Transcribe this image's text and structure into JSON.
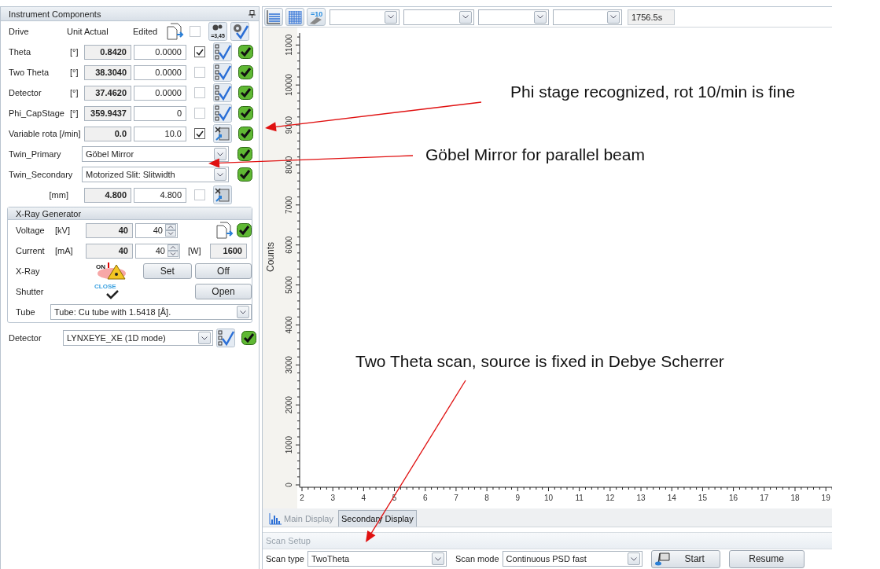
{
  "panel": {
    "title": "Instrument Components",
    "header": {
      "drive": "Drive",
      "unit_actual": "Unit Actual",
      "edited": "Edited",
      "icon_text": "=3,45",
      "checked": false
    },
    "drives": [
      {
        "kind": "axis",
        "label": "Theta",
        "unit": "[°]",
        "actual": "0.8420",
        "edited": "0.0000",
        "checked": true
      },
      {
        "kind": "axis",
        "label": "Two Theta",
        "unit": "[°]",
        "actual": "38.3040",
        "edited": "0.0000",
        "checked": false
      },
      {
        "kind": "axis",
        "label": "Detector",
        "unit": "[°]",
        "actual": "37.4620",
        "edited": "0.0000",
        "checked": false
      },
      {
        "kind": "axis",
        "label": "Phi_CapStage",
        "unit": "[°]",
        "actual": "359.9437",
        "edited": "0",
        "checked": false
      },
      {
        "kind": "rotation",
        "label": "Variable rota [/min]",
        "actual": "0.0",
        "edited": "10.0",
        "checked": true
      }
    ],
    "selectors": [
      {
        "label": "Twin_Primary",
        "value": "Göbel Mirror"
      },
      {
        "label": "Twin_Secondary",
        "value": "Motorized Slit: Slitwidth"
      }
    ],
    "slit": {
      "unit": "[mm]",
      "actual": "4.800",
      "edited": "4.800",
      "checked": false
    },
    "generator": {
      "title": "X-Ray Generator",
      "voltage": {
        "label": "Voltage",
        "unit": "[kV]",
        "actual": "40",
        "edited": "40"
      },
      "current": {
        "label": "Current",
        "unit": "[mA]",
        "actual": "40",
        "edited": "40"
      },
      "power_unit": "[W]",
      "power": "1600",
      "xray": {
        "label": "X-Ray",
        "badge": "ON",
        "set": "Set",
        "off": "Off"
      },
      "shutter": {
        "label": "Shutter",
        "badge": "CLOSE",
        "open": "Open"
      },
      "tube": {
        "label": "Tube",
        "value": "Tube: Cu tube with 1.5418 [Å]."
      }
    },
    "detector": {
      "label": "Detector",
      "value": "LYNXEYE_XE (1D mode)"
    }
  },
  "toolbar": {
    "icon_text": "=10",
    "time": "1756.5s"
  },
  "chart": {
    "chart_data": {
      "type": "line",
      "ylabel": "Counts",
      "xlim": [
        2,
        19.2
      ],
      "ylim": [
        0,
        11300
      ],
      "xticks": [
        2,
        3,
        4,
        5,
        6,
        7,
        8,
        9,
        10,
        11,
        12,
        13,
        14,
        15,
        16,
        17,
        18,
        19
      ],
      "yticks": [
        0,
        1000,
        2000,
        3000,
        4000,
        5000,
        6000,
        7000,
        8000,
        9000,
        10000,
        11000
      ]
    }
  },
  "tabs": [
    {
      "label": "Main Display",
      "selected": false
    },
    {
      "label": "Secondary Display",
      "selected": true
    }
  ],
  "scan_setup": {
    "title": "Scan Setup",
    "scan_type_label": "Scan type",
    "scan_type": "TwoTheta",
    "scan_mode_label": "Scan mode",
    "scan_mode": "Continuous PSD fast",
    "start": "Start",
    "resume": "Resume"
  },
  "annotations": [
    {
      "text": "Phi stage recognized, rot 10/min is fine"
    },
    {
      "text": "Göbel Mirror for parallel beam"
    },
    {
      "text": "Two Theta scan, source is fixed in Debye Scherrer"
    }
  ]
}
